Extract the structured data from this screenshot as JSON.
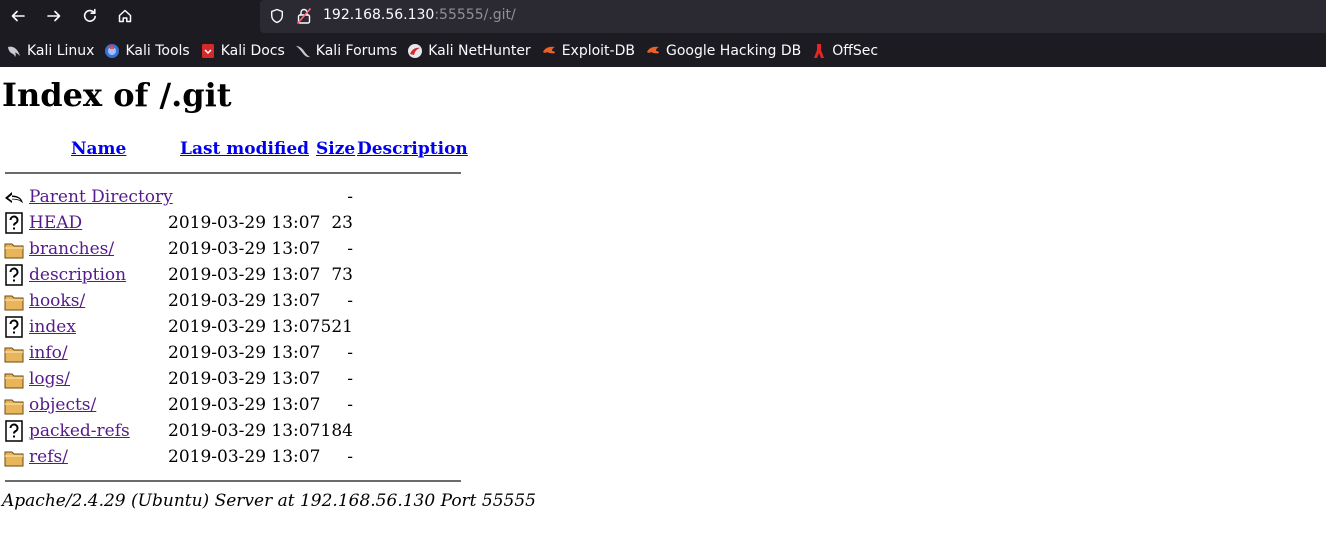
{
  "browser": {
    "url_host": "192.168.56.130",
    "url_rest": ":55555/.git/",
    "bookmarks": [
      {
        "label": "Kali Linux",
        "icon": "kali-dragon-icon"
      },
      {
        "label": "Kali Tools",
        "icon": "kali-tools-icon"
      },
      {
        "label": "Kali Docs",
        "icon": "kali-docs-icon"
      },
      {
        "label": "Kali Forums",
        "icon": "kali-forums-icon"
      },
      {
        "label": "Kali NetHunter",
        "icon": "nethunter-icon"
      },
      {
        "label": "Exploit-DB",
        "icon": "exploitdb-icon"
      },
      {
        "label": "Google Hacking DB",
        "icon": "ghdb-icon"
      },
      {
        "label": "OffSec",
        "icon": "offsec-icon"
      }
    ]
  },
  "page": {
    "title": "Index of /.git",
    "columns": {
      "name": "Name",
      "modified": "Last modified",
      "size": "Size",
      "description": "Description"
    },
    "entries": [
      {
        "icon": "back-icon",
        "name": "Parent Directory",
        "modified": "",
        "size": "-"
      },
      {
        "icon": "unknown-file-icon",
        "name": "HEAD",
        "modified": "2019-03-29 13:07",
        "size": "23"
      },
      {
        "icon": "folder-icon",
        "name": "branches/",
        "modified": "2019-03-29 13:07",
        "size": "-"
      },
      {
        "icon": "unknown-file-icon",
        "name": "description",
        "modified": "2019-03-29 13:07",
        "size": "73"
      },
      {
        "icon": "folder-icon",
        "name": "hooks/",
        "modified": "2019-03-29 13:07",
        "size": "-"
      },
      {
        "icon": "unknown-file-icon",
        "name": "index",
        "modified": "2019-03-29 13:07",
        "size": "521"
      },
      {
        "icon": "folder-icon",
        "name": "info/",
        "modified": "2019-03-29 13:07",
        "size": "-"
      },
      {
        "icon": "folder-icon",
        "name": "logs/",
        "modified": "2019-03-29 13:07",
        "size": "-"
      },
      {
        "icon": "folder-icon",
        "name": "objects/",
        "modified": "2019-03-29 13:07",
        "size": "-"
      },
      {
        "icon": "unknown-file-icon",
        "name": "packed-refs",
        "modified": "2019-03-29 13:07",
        "size": "184"
      },
      {
        "icon": "folder-icon",
        "name": "refs/",
        "modified": "2019-03-29 13:07",
        "size": "-"
      }
    ],
    "server_signature": "Apache/2.4.29 (Ubuntu) Server at 192.168.56.130 Port 55555"
  },
  "colors": {
    "chrome_bg": "#1c1b22",
    "urlbar_bg": "#2b2a33",
    "link": "#0000ee",
    "visited_link": "#551a8b"
  }
}
